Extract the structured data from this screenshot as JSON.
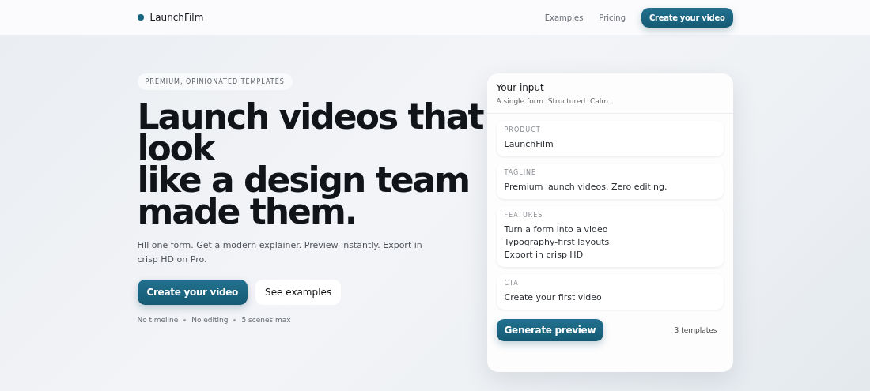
{
  "nav": {
    "brand": "LaunchFilm",
    "links": [
      "Examples",
      "Pricing"
    ],
    "cta": "Create your video"
  },
  "hero": {
    "eyebrow": "PREMIUM, OPINIONATED TEMPLATES",
    "headline_lines": [
      "Launch videos that",
      "look",
      "like a design team",
      "made them."
    ],
    "subtitle": "Fill one form. Get a modern explainer. Preview instantly. Export in crisp HD on Pro.",
    "primary_button": "Create your video",
    "secondary_button": "See examples",
    "notes": [
      "No timeline",
      "No editing",
      "5 scenes max"
    ]
  },
  "form_card": {
    "title": "Your input",
    "subtitle": "A single form. Structured. Calm.",
    "fields": [
      {
        "label": "PRODUCT",
        "lines": [
          "LaunchFilm"
        ]
      },
      {
        "label": "TAGLINE",
        "lines": [
          "Premium launch videos. Zero editing."
        ]
      },
      {
        "label": "FEATURES",
        "lines": [
          "Turn a form into a video",
          "Typography-first layouts",
          "Export in crisp HD"
        ]
      },
      {
        "label": "CTA",
        "lines": [
          "Create your first video"
        ]
      }
    ],
    "button": "Generate preview",
    "count": "3 templates"
  }
}
